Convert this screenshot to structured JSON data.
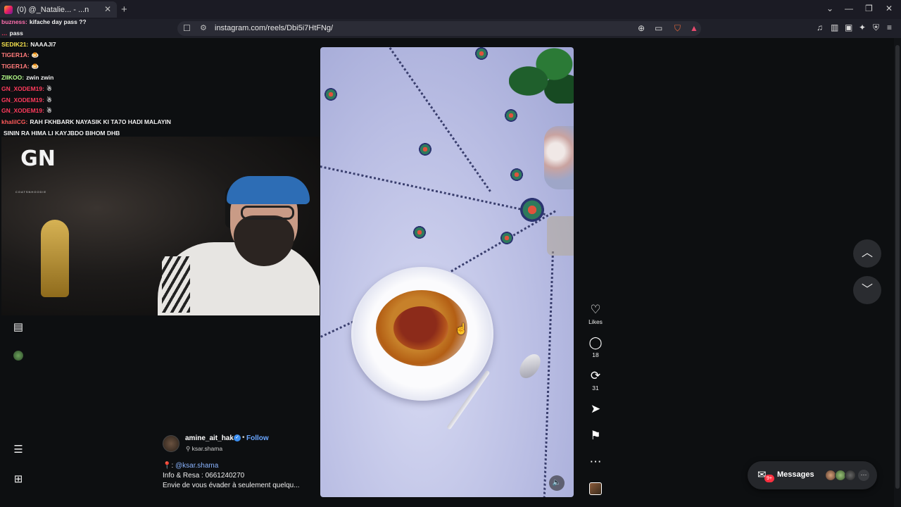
{
  "browser": {
    "tab_title": "(0) @_Natalie... - ...n",
    "url": "instagram.com/reels/Dbi5i7HtFNg/",
    "icons": [
      "bookmark-icon",
      "site-info-icon",
      "zoom-icon",
      "cast-icon",
      "brave-shield-icon",
      "brave-rewards-icon",
      "media-icon",
      "sidebar-icon",
      "wallet-icon",
      "leo-icon",
      "vpn-icon",
      "menu-icon"
    ]
  },
  "chat": [
    {
      "user": "buzness:",
      "msg": "kifache day pass ??",
      "color": "#ff6fae"
    },
    {
      "user": "…",
      "msg": "pass",
      "color": "#ff3b5c"
    },
    {
      "user": "SEDIK21:",
      "msg": "NAAAJI7",
      "color": "#f4e04d"
    },
    {
      "user": "TIGER1A:",
      "msg": "🍮",
      "color": "#ff7a7a"
    },
    {
      "user": "TIGER1A:",
      "msg": "🍮",
      "color": "#ff7a7a"
    },
    {
      "user": "ZIIKOO:",
      "msg": "zwin zwin",
      "color": "#b6ff8a"
    },
    {
      "user": "GN_XODEM19:",
      "msg": "☃",
      "color": "#ff3b5c"
    },
    {
      "user": "GN_XODEM19:",
      "msg": "☃",
      "color": "#ff3b5c"
    },
    {
      "user": "GN_XODEM19:",
      "msg": "☃",
      "color": "#ff3b5c"
    },
    {
      "user": "khalilCG:",
      "msg": "RAH FKHBARK NAYASIK KI TA7O HADI MALAYIN",
      "color": "#ff5a5a"
    },
    {
      "user": "",
      "msg": "SININ RA HIMA LI KAYJBDO BIHOM DHB",
      "color": "#ffffff"
    }
  ],
  "cam": {
    "logo": "GN",
    "logo_sub": "COATSNHOODIE"
  },
  "post": {
    "username": "amine_ait_hak",
    "follow_label": "Follow",
    "location": "ksar.shama",
    "mention_prefix": ": ",
    "mention": "@ksar.shama",
    "info_line": "Info & Resa : 0661240270",
    "desc_line": "Envie de vous évader à seulement quelqu..."
  },
  "actions": {
    "likes_label": "Likes",
    "comments_count": "18",
    "reposts_count": "31"
  },
  "messages": {
    "label": "Messages",
    "badge": "9+"
  }
}
